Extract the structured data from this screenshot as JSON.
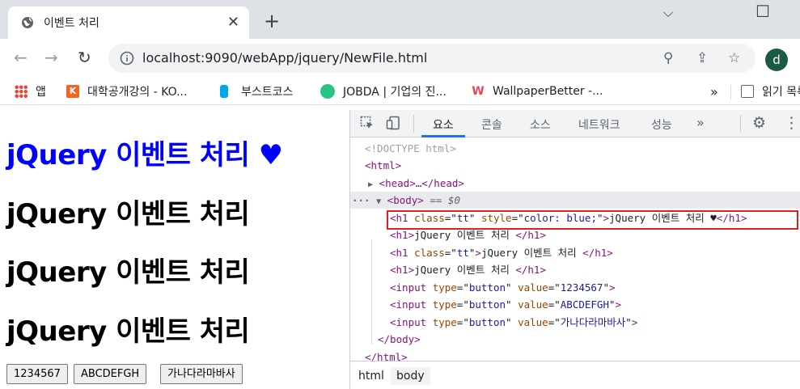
{
  "browser": {
    "tab_title": "이벤트 처리",
    "url": "localhost:9090/webApp/jquery/NewFile.html",
    "profile_initial": "d"
  },
  "bookmarks": [
    {
      "label": "앱",
      "icon": "apps-grid-icon",
      "color": "#ea4335"
    },
    {
      "label": "대학공개강의 - KO...",
      "icon": "kocw-icon",
      "color": "#f26522"
    },
    {
      "label": "부스트코스",
      "icon": "boostcourse-icon",
      "color": "#00a8e8"
    },
    {
      "label": "JOBDA | 기업의 진...",
      "icon": "jobda-icon",
      "color": "#27c485"
    },
    {
      "label": "WallpaperBetter -...",
      "icon": "wallpaperbetter-icon",
      "color": "#e8445a"
    },
    {
      "label": "읽기 목록",
      "icon": "reading-list-icon",
      "color": "#5f6368"
    }
  ],
  "page": {
    "headings": [
      {
        "text": "jQuery 이벤트 처리 ♥",
        "color": "#0000ff"
      },
      {
        "text": "jQuery 이벤트 처리",
        "color": "#000000"
      },
      {
        "text": "jQuery 이벤트 처리",
        "color": "#000000"
      },
      {
        "text": "jQuery 이벤트 처리",
        "color": "#000000"
      }
    ],
    "buttons": [
      "1234567",
      "ABCDEFGH",
      "가나다라마바사"
    ]
  },
  "devtools": {
    "tabs": [
      "요소",
      "콘솔",
      "소스",
      "네트워크",
      "성능",
      "»"
    ],
    "active_tab": "요소",
    "dom": {
      "doctype": "<!DOCTYPE html>",
      "html_open": "<html>",
      "head": "<head>…</head>",
      "body_open": "<body>",
      "body_marker": "== $0",
      "h1_tt_blue": {
        "tag": "h1",
        "class": "tt",
        "style": "color: blue;",
        "text": "jQuery 이벤트 처리 ♥"
      },
      "h1_plain_1": {
        "tag": "h1",
        "text": "jQuery 이벤트 처리 "
      },
      "h1_tt": {
        "tag": "h1",
        "class": "tt",
        "text": "jQuery 이벤트 처리 "
      },
      "h1_plain_2": {
        "tag": "h1",
        "text": "jQuery 이벤트 처리 "
      },
      "inputs": [
        {
          "type": "button",
          "value": "1234567"
        },
        {
          "type": "button",
          "value": "ABCDEFGH"
        },
        {
          "type": "button",
          "value": "가나다라마바사"
        }
      ],
      "body_close": "</body>",
      "html_close": "</html>"
    },
    "breadcrumbs": [
      "html",
      "body"
    ],
    "active_crumb": "body"
  },
  "highlight_color": "#e0201f"
}
